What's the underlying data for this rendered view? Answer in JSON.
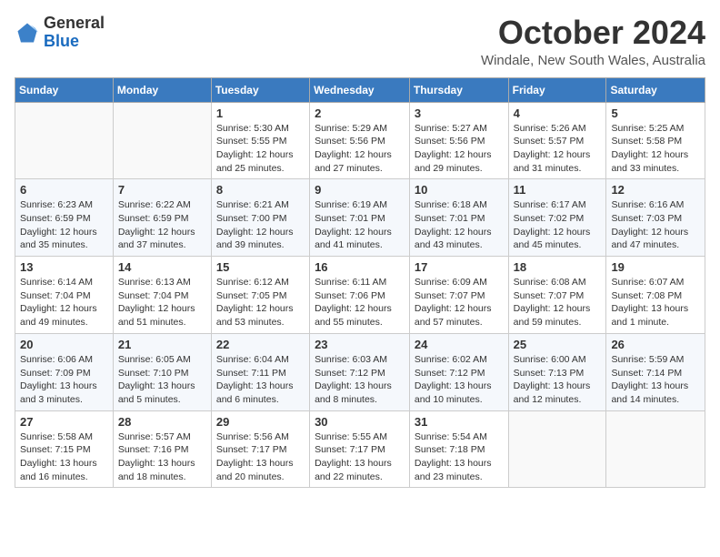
{
  "logo": {
    "general": "General",
    "blue": "Blue"
  },
  "title": "October 2024",
  "location": "Windale, New South Wales, Australia",
  "days_of_week": [
    "Sunday",
    "Monday",
    "Tuesday",
    "Wednesday",
    "Thursday",
    "Friday",
    "Saturday"
  ],
  "weeks": [
    [
      {
        "day": "",
        "sunrise": "",
        "sunset": "",
        "daylight": ""
      },
      {
        "day": "",
        "sunrise": "",
        "sunset": "",
        "daylight": ""
      },
      {
        "day": "1",
        "sunrise": "Sunrise: 5:30 AM",
        "sunset": "Sunset: 5:55 PM",
        "daylight": "Daylight: 12 hours and 25 minutes."
      },
      {
        "day": "2",
        "sunrise": "Sunrise: 5:29 AM",
        "sunset": "Sunset: 5:56 PM",
        "daylight": "Daylight: 12 hours and 27 minutes."
      },
      {
        "day": "3",
        "sunrise": "Sunrise: 5:27 AM",
        "sunset": "Sunset: 5:56 PM",
        "daylight": "Daylight: 12 hours and 29 minutes."
      },
      {
        "day": "4",
        "sunrise": "Sunrise: 5:26 AM",
        "sunset": "Sunset: 5:57 PM",
        "daylight": "Daylight: 12 hours and 31 minutes."
      },
      {
        "day": "5",
        "sunrise": "Sunrise: 5:25 AM",
        "sunset": "Sunset: 5:58 PM",
        "daylight": "Daylight: 12 hours and 33 minutes."
      }
    ],
    [
      {
        "day": "6",
        "sunrise": "Sunrise: 6:23 AM",
        "sunset": "Sunset: 6:59 PM",
        "daylight": "Daylight: 12 hours and 35 minutes."
      },
      {
        "day": "7",
        "sunrise": "Sunrise: 6:22 AM",
        "sunset": "Sunset: 6:59 PM",
        "daylight": "Daylight: 12 hours and 37 minutes."
      },
      {
        "day": "8",
        "sunrise": "Sunrise: 6:21 AM",
        "sunset": "Sunset: 7:00 PM",
        "daylight": "Daylight: 12 hours and 39 minutes."
      },
      {
        "day": "9",
        "sunrise": "Sunrise: 6:19 AM",
        "sunset": "Sunset: 7:01 PM",
        "daylight": "Daylight: 12 hours and 41 minutes."
      },
      {
        "day": "10",
        "sunrise": "Sunrise: 6:18 AM",
        "sunset": "Sunset: 7:01 PM",
        "daylight": "Daylight: 12 hours and 43 minutes."
      },
      {
        "day": "11",
        "sunrise": "Sunrise: 6:17 AM",
        "sunset": "Sunset: 7:02 PM",
        "daylight": "Daylight: 12 hours and 45 minutes."
      },
      {
        "day": "12",
        "sunrise": "Sunrise: 6:16 AM",
        "sunset": "Sunset: 7:03 PM",
        "daylight": "Daylight: 12 hours and 47 minutes."
      }
    ],
    [
      {
        "day": "13",
        "sunrise": "Sunrise: 6:14 AM",
        "sunset": "Sunset: 7:04 PM",
        "daylight": "Daylight: 12 hours and 49 minutes."
      },
      {
        "day": "14",
        "sunrise": "Sunrise: 6:13 AM",
        "sunset": "Sunset: 7:04 PM",
        "daylight": "Daylight: 12 hours and 51 minutes."
      },
      {
        "day": "15",
        "sunrise": "Sunrise: 6:12 AM",
        "sunset": "Sunset: 7:05 PM",
        "daylight": "Daylight: 12 hours and 53 minutes."
      },
      {
        "day": "16",
        "sunrise": "Sunrise: 6:11 AM",
        "sunset": "Sunset: 7:06 PM",
        "daylight": "Daylight: 12 hours and 55 minutes."
      },
      {
        "day": "17",
        "sunrise": "Sunrise: 6:09 AM",
        "sunset": "Sunset: 7:07 PM",
        "daylight": "Daylight: 12 hours and 57 minutes."
      },
      {
        "day": "18",
        "sunrise": "Sunrise: 6:08 AM",
        "sunset": "Sunset: 7:07 PM",
        "daylight": "Daylight: 12 hours and 59 minutes."
      },
      {
        "day": "19",
        "sunrise": "Sunrise: 6:07 AM",
        "sunset": "Sunset: 7:08 PM",
        "daylight": "Daylight: 13 hours and 1 minute."
      }
    ],
    [
      {
        "day": "20",
        "sunrise": "Sunrise: 6:06 AM",
        "sunset": "Sunset: 7:09 PM",
        "daylight": "Daylight: 13 hours and 3 minutes."
      },
      {
        "day": "21",
        "sunrise": "Sunrise: 6:05 AM",
        "sunset": "Sunset: 7:10 PM",
        "daylight": "Daylight: 13 hours and 5 minutes."
      },
      {
        "day": "22",
        "sunrise": "Sunrise: 6:04 AM",
        "sunset": "Sunset: 7:11 PM",
        "daylight": "Daylight: 13 hours and 6 minutes."
      },
      {
        "day": "23",
        "sunrise": "Sunrise: 6:03 AM",
        "sunset": "Sunset: 7:12 PM",
        "daylight": "Daylight: 13 hours and 8 minutes."
      },
      {
        "day": "24",
        "sunrise": "Sunrise: 6:02 AM",
        "sunset": "Sunset: 7:12 PM",
        "daylight": "Daylight: 13 hours and 10 minutes."
      },
      {
        "day": "25",
        "sunrise": "Sunrise: 6:00 AM",
        "sunset": "Sunset: 7:13 PM",
        "daylight": "Daylight: 13 hours and 12 minutes."
      },
      {
        "day": "26",
        "sunrise": "Sunrise: 5:59 AM",
        "sunset": "Sunset: 7:14 PM",
        "daylight": "Daylight: 13 hours and 14 minutes."
      }
    ],
    [
      {
        "day": "27",
        "sunrise": "Sunrise: 5:58 AM",
        "sunset": "Sunset: 7:15 PM",
        "daylight": "Daylight: 13 hours and 16 minutes."
      },
      {
        "day": "28",
        "sunrise": "Sunrise: 5:57 AM",
        "sunset": "Sunset: 7:16 PM",
        "daylight": "Daylight: 13 hours and 18 minutes."
      },
      {
        "day": "29",
        "sunrise": "Sunrise: 5:56 AM",
        "sunset": "Sunset: 7:17 PM",
        "daylight": "Daylight: 13 hours and 20 minutes."
      },
      {
        "day": "30",
        "sunrise": "Sunrise: 5:55 AM",
        "sunset": "Sunset: 7:17 PM",
        "daylight": "Daylight: 13 hours and 22 minutes."
      },
      {
        "day": "31",
        "sunrise": "Sunrise: 5:54 AM",
        "sunset": "Sunset: 7:18 PM",
        "daylight": "Daylight: 13 hours and 23 minutes."
      },
      {
        "day": "",
        "sunrise": "",
        "sunset": "",
        "daylight": ""
      },
      {
        "day": "",
        "sunrise": "",
        "sunset": "",
        "daylight": ""
      }
    ]
  ]
}
